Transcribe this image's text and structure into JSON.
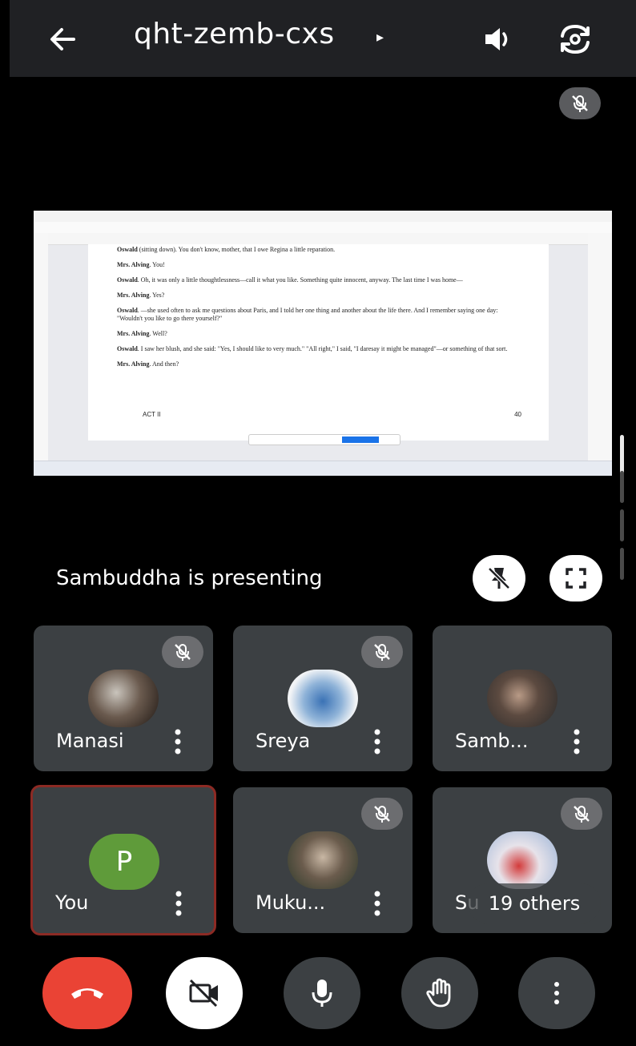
{
  "header": {
    "meeting_code": "qht-zemb-cxs",
    "caret": "▸"
  },
  "presentation": {
    "presenter_text": "Sambuddha is presenting",
    "document": {
      "lines": [
        {
          "speaker": "Oswald",
          "text": " (sitting down). You don't know, mother, that I owe Regina a little reparation."
        },
        {
          "speaker": "Mrs. Alving",
          "text": ". You!"
        },
        {
          "speaker": "Oswald",
          "text": ". Oh, it was only a little thoughtlessness—call it what you like. Something quite innocent, anyway. The last time I was home—"
        },
        {
          "speaker": "Mrs. Alving",
          "text": ". Yes?"
        },
        {
          "speaker": "Oswald",
          "text": ". —she used often to ask me questions about Paris, and I told her one thing and another about the life there. And I remember saying one day: \"Wouldn't you like to go there yourself?\""
        },
        {
          "speaker": "Mrs. Alving",
          "text": ". Well?"
        },
        {
          "speaker": "Oswald",
          "text": ". I saw her blush, and she said: \"Yes, I should like to very much.\" \"All right,\" I said, \"I daresay it might be managed\"—or something of that sort."
        },
        {
          "speaker": "Mrs. Alving",
          "text": ". And then?"
        }
      ],
      "footer_left": "ACT II",
      "footer_right": "40"
    }
  },
  "participants": [
    {
      "name": "Manasi",
      "muted": true
    },
    {
      "name": "Sreya",
      "muted": true
    },
    {
      "name": "Samb...",
      "muted": false
    },
    {
      "name": "You",
      "initial": "P",
      "muted": false
    },
    {
      "name": "Muku...",
      "muted": true
    },
    {
      "name": "Su",
      "muted": true
    }
  ],
  "others_label": "19 others",
  "colors": {
    "end_call": "#ea4335",
    "tile_bg": "#3c4043",
    "you_avatar": "#5f9b3a"
  }
}
